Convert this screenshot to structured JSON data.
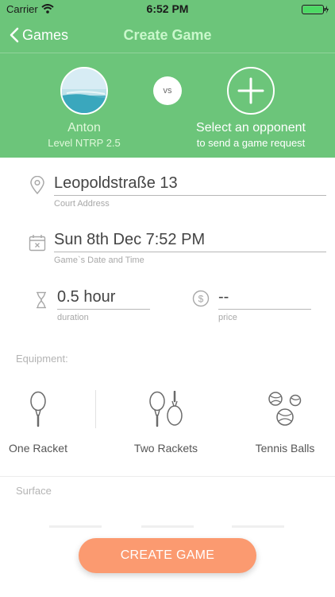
{
  "status_bar": {
    "carrier": "Carrier",
    "time": "6:52 PM"
  },
  "nav": {
    "back_label": "Games",
    "title": "Create Game"
  },
  "player": {
    "name": "Anton",
    "level": "Level NTRP 2.5"
  },
  "vs_label": "vs",
  "opponent": {
    "title": "Select an opponent",
    "subtitle": "to send a game request"
  },
  "court": {
    "value": "Leopoldstraße 13",
    "caption": "Court Address"
  },
  "datetime": {
    "value": "Sun 8th Dec  7:52 PM",
    "caption": "Game`s Date and Time"
  },
  "duration": {
    "value": "0.5 hour",
    "caption": "duration"
  },
  "price": {
    "value": "--",
    "caption": "price"
  },
  "equipment": {
    "label": "Equipment:",
    "items": [
      {
        "label": "One Racket",
        "icon": "racket-icon"
      },
      {
        "label": "Two Rackets",
        "icon": "two-rackets-icon"
      },
      {
        "label": "Tennis Balls",
        "icon": "tennis-balls-icon"
      }
    ]
  },
  "surface": {
    "label": "Surface"
  },
  "create_button": "CREATE GAME",
  "colors": {
    "header_green": "#6cc57a",
    "button_orange": "#fb9a70"
  }
}
